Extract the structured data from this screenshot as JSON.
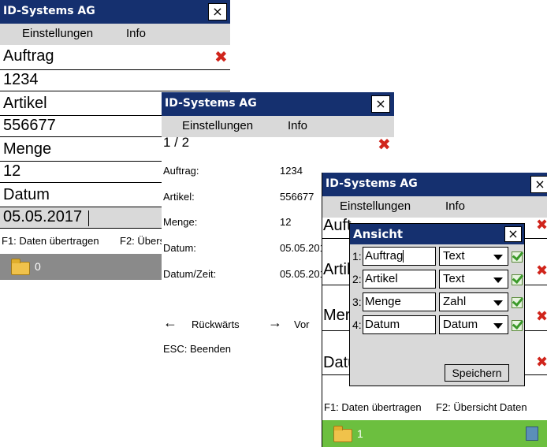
{
  "app_title": "ID-Systems AG",
  "close_symbol": "×",
  "menu": {
    "settings": "Einstellungen",
    "info": "Info"
  },
  "screen1": {
    "fields": [
      {
        "label": "Auftrag",
        "value": "1234"
      },
      {
        "label": "Artikel",
        "value": "556677"
      },
      {
        "label": "Menge",
        "value": "12"
      },
      {
        "label": "Datum",
        "value": "05.05.2017"
      }
    ],
    "delete_symbol": "✖",
    "f1": "F1: Daten übertragen",
    "f2": "F2: Übers",
    "count": "0"
  },
  "screen2": {
    "page": "1 / 2",
    "delete_symbol": "✖",
    "rows": [
      {
        "label": "Auftrag:",
        "value": "1234"
      },
      {
        "label": "Artikel:",
        "value": "556677"
      },
      {
        "label": "Menge:",
        "value": "12"
      },
      {
        "label": "Datum:",
        "value": "05.05.201"
      },
      {
        "label": "Datum/Zeit:",
        "value": "05.05.201"
      }
    ],
    "back": "Rückwärts",
    "forward": "Vor",
    "back_arrow": "←",
    "forward_arrow": "→",
    "esc": "ESC: Beenden"
  },
  "screen3": {
    "bg_labels": [
      "Auft",
      "Artik",
      "Mer",
      "Datu"
    ],
    "delete_symbol": "✖",
    "f1": "F1: Daten übertragen",
    "f2": "F2: Übersicht Daten",
    "count": "1",
    "status_color": "#6cbf3f"
  },
  "dialog": {
    "title": "Ansicht",
    "rows": [
      {
        "num": "1:",
        "name": "Auftrag",
        "type": "Text",
        "checked": true
      },
      {
        "num": "2:",
        "name": "Artikel",
        "type": "Text",
        "checked": true
      },
      {
        "num": "3:",
        "name": "Menge",
        "type": "Zahl",
        "checked": true
      },
      {
        "num": "4:",
        "name": "Datum",
        "type": "Datum",
        "checked": true
      }
    ],
    "save": "Speichern"
  }
}
